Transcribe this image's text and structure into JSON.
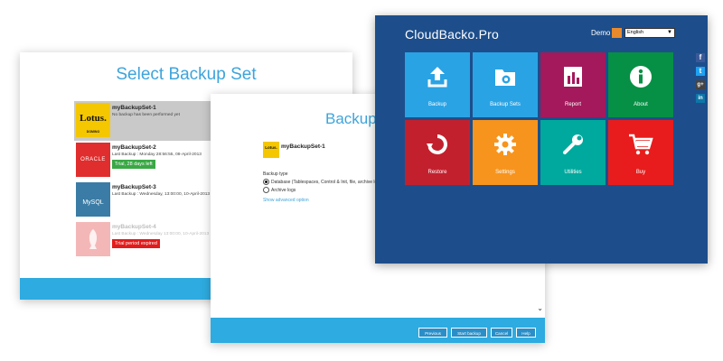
{
  "select_window": {
    "title": "Select Backup Set",
    "sets": [
      {
        "logo": "Lotus.",
        "logo_sub": "DOMINO",
        "name": "myBackupSet-1",
        "info": "No backup has been performed yet",
        "badge": ""
      },
      {
        "logo": "ORACLE",
        "logo_sub": "",
        "name": "myBackupSet-2",
        "info": "Last Backup : Monday 28:56:55, 08-April-2013",
        "badge": "Trial, 28 days left",
        "badge_color": "#3aa845"
      },
      {
        "logo": "MySQL",
        "logo_sub": "",
        "name": "myBackupSet-3",
        "info": "Last Backup : Wednesday, 13:00:00, 10-April-2013",
        "badge": ""
      },
      {
        "logo": "",
        "logo_sub": "",
        "name": "myBackupSet-4",
        "info": "Last Backup : Wednesday 13:00:00, 10-April-2013",
        "badge": "Trial period expired",
        "badge_color": "#e21c1c"
      }
    ]
  },
  "backup_window": {
    "title": "Backup",
    "set_logo": "Lotus.",
    "set_name": "myBackupSet-1",
    "backup_type_label": "Backup type",
    "options": [
      {
        "label": "Database (Tablespaces, Control & Init, file, archive logs)",
        "selected": true
      },
      {
        "label": "Archive logs",
        "selected": false
      }
    ],
    "advanced_link": "Show advanced option",
    "buttons": {
      "previous": "Previous",
      "start": "Start backup",
      "cancel": "Cancel",
      "help": "Help"
    }
  },
  "dashboard": {
    "brand": "CloudBacko.Pro",
    "user": "Demo",
    "language": "English",
    "tiles": [
      {
        "label": "Backup",
        "color": "#2aa3e4",
        "icon": "upload-icon"
      },
      {
        "label": "Backup Sets",
        "color": "#2aa3e4",
        "icon": "folder-gear-icon"
      },
      {
        "label": "Report",
        "color": "#a3195b",
        "icon": "report-chart-icon"
      },
      {
        "label": "About",
        "color": "#069045",
        "icon": "info-icon"
      },
      {
        "label": "Restore",
        "color": "#c3202e",
        "icon": "restore-icon"
      },
      {
        "label": "Settings",
        "color": "#f7941d",
        "icon": "gear-icon"
      },
      {
        "label": "Utilities",
        "color": "#00a99d",
        "icon": "wrench-icon"
      },
      {
        "label": "Buy",
        "color": "#e81c1c",
        "icon": "cart-icon"
      }
    ]
  },
  "social": [
    {
      "glyph": "f",
      "color": "#3b5998",
      "name": "facebook-icon"
    },
    {
      "glyph": "t",
      "color": "#1da1f2",
      "name": "twitter-icon"
    },
    {
      "glyph": "g+",
      "color": "#444444",
      "name": "googleplus-icon"
    },
    {
      "glyph": "in",
      "color": "#0e76a8",
      "name": "linkedin-icon"
    }
  ]
}
